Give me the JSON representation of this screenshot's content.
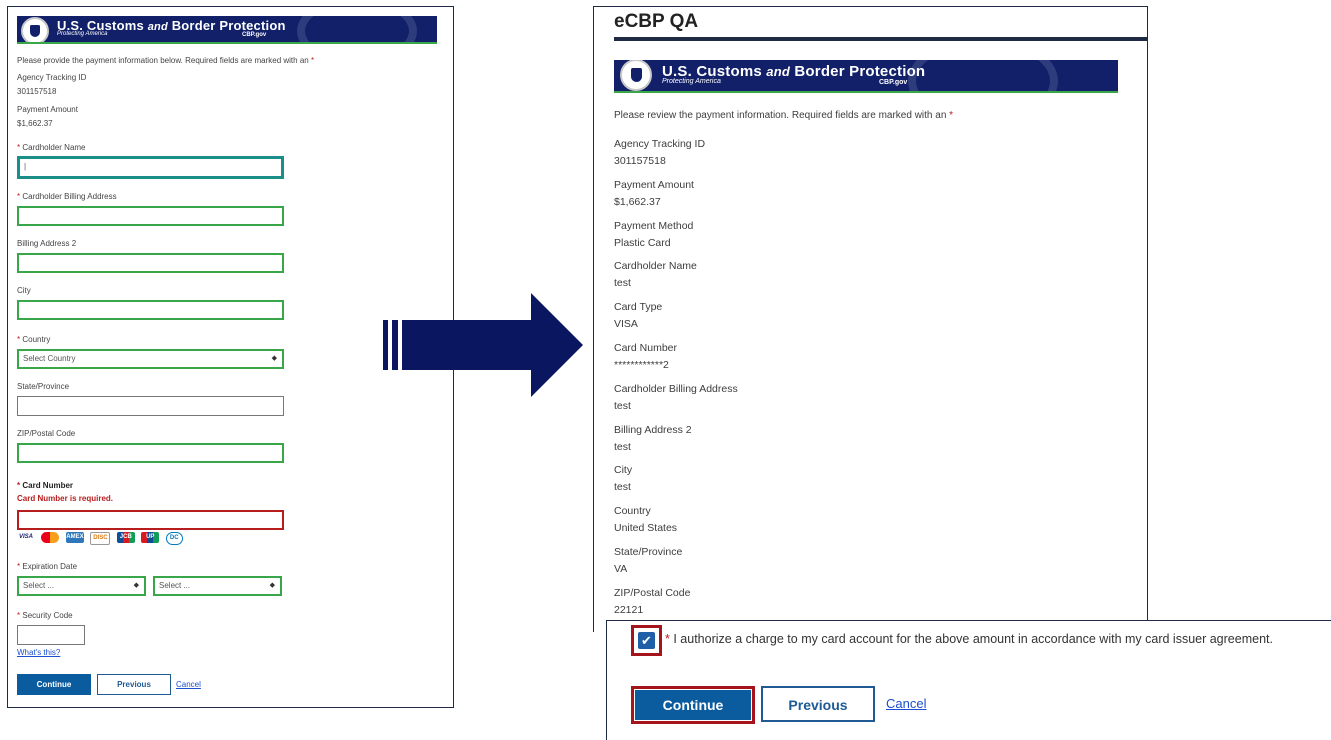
{
  "banner": {
    "agency_part1": "U.S. Customs ",
    "agency_and": "and",
    "agency_part2": " Border Protection",
    "tagline": "Protecting America",
    "site": "CBP.gov"
  },
  "left_form": {
    "instructions_prefix": "Please provide the payment information below. Required fields are marked with an ",
    "required_marker": "*",
    "agency_tracking_label": "Agency Tracking ID",
    "agency_tracking_value": "301157518",
    "payment_amount_label": "Payment Amount",
    "payment_amount_value": "$1,662.37",
    "cardholder_name_label": "Cardholder Name",
    "cardholder_name_value": "|",
    "billing_address_label": "Cardholder Billing Address",
    "billing_address2_label": "Billing Address 2",
    "city_label": "City",
    "country_label": "Country",
    "country_selected": "Select Country",
    "state_label": "State/Province",
    "zip_label": "ZIP/Postal Code",
    "card_number_label": "Card Number",
    "card_number_error": "Card Number is required.",
    "card_brands": [
      "VISA",
      "MC",
      "AMEX",
      "DISC",
      "JCB",
      "UP",
      "DC"
    ],
    "expiration_label": "Expiration Date",
    "exp_month_selected": "Select ...",
    "exp_year_selected": "Select ...",
    "security_code_label": "Security Code",
    "whats_this": "What's this?",
    "continue_label": "Continue",
    "previous_label": "Previous",
    "cancel_label": "Cancel"
  },
  "review": {
    "title": "eCBP QA",
    "instructions_prefix": "Please review the payment information. Required fields are marked with an ",
    "required_marker": "*",
    "fields": [
      {
        "label": "Agency Tracking ID",
        "value": "301157518"
      },
      {
        "label": "Payment Amount",
        "value": "$1,662.37"
      },
      {
        "label": "Payment Method",
        "value": "Plastic Card"
      },
      {
        "label": "Cardholder Name",
        "value": "test"
      },
      {
        "label": "Card Type",
        "value": "VISA"
      },
      {
        "label": "Card Number",
        "value": "************2"
      },
      {
        "label": "Cardholder Billing Address",
        "value": "test"
      },
      {
        "label": "Billing Address 2",
        "value": "test"
      },
      {
        "label": "City",
        "value": "test"
      },
      {
        "label": "Country",
        "value": "United States"
      },
      {
        "label": "State/Province",
        "value": "VA"
      },
      {
        "label": "ZIP/Postal Code",
        "value": "22121"
      }
    ],
    "authorize_marker": "*",
    "authorize_text": " I authorize a charge to my card account for the above amount in accordance with my card issuer agreement.",
    "authorize_checked": true,
    "continue_label": "Continue",
    "previous_label": "Previous",
    "cancel_label": "Cancel"
  },
  "colors": {
    "banner_navy": "#12206a",
    "valid_border": "#3aa64a",
    "error_red": "#b81d1d",
    "primary_button": "#0b5c9e",
    "highlight_red": "#a3141c",
    "arrow_navy": "#0b1660"
  },
  "icons": {
    "seal": "dhs-seal-icon",
    "arrow": "right-arrow-icon",
    "checkmark": "checkmark-icon",
    "caret": "select-caret-icon"
  }
}
